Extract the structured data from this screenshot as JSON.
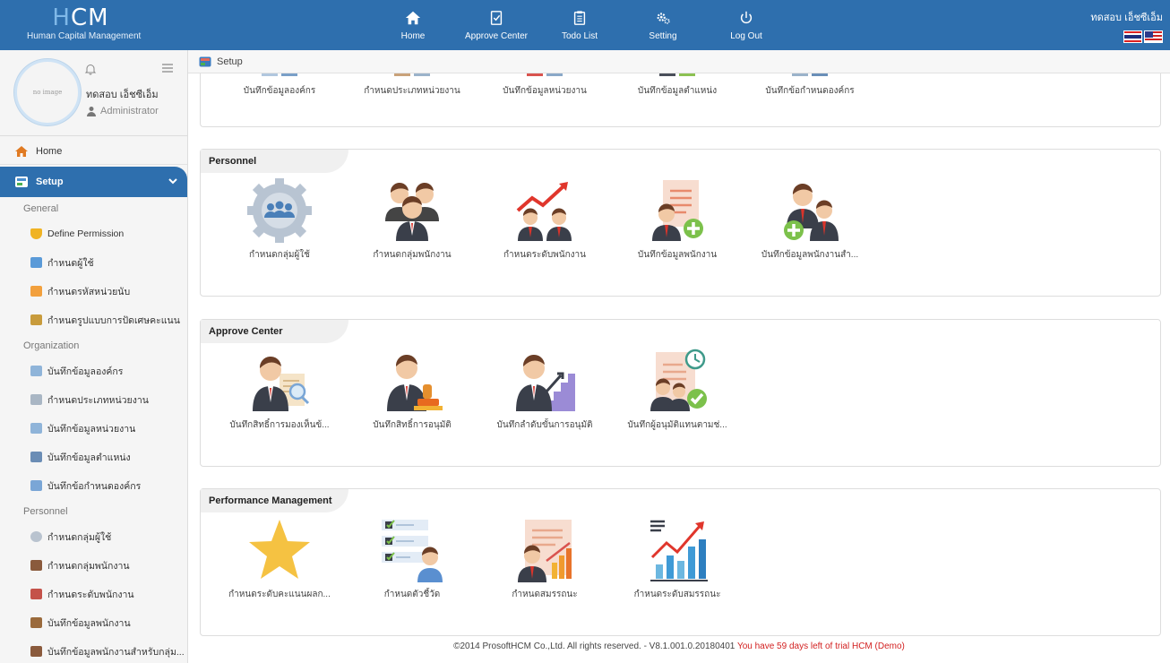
{
  "header": {
    "brand_logo": "HCM",
    "brand_subtitle": "Human Capital Management",
    "nav": [
      {
        "label": "Home",
        "icon": "home-icon"
      },
      {
        "label": "Approve Center",
        "icon": "approve-icon"
      },
      {
        "label": "Todo List",
        "icon": "clipboard-icon"
      },
      {
        "label": "Setting",
        "icon": "gears-icon"
      },
      {
        "label": "Log Out",
        "icon": "power-icon"
      }
    ],
    "user_name": "ทดสอบ เอ็ชซีเอ็ม"
  },
  "sidebar": {
    "avatar_text": "no image",
    "user_name": "ทดสอบ เอ็ชซีเอ็ม",
    "user_role": "Administrator",
    "home_label": "Home",
    "setup_label": "Setup",
    "groups": [
      {
        "title": "General",
        "items": [
          "Define Permission",
          "กำหนดผู้ใช้",
          "กำหนดรหัสหน่วยนับ",
          "กำหนดรูปแบบการปัดเศษคะแนน"
        ]
      },
      {
        "title": "Organization",
        "items": [
          "บันทึกข้อมูลองค์กร",
          "กำหนดประเภทหน่วยงาน",
          "บันทึกข้อมูลหน่วยงาน",
          "บันทึกข้อมูลตำแหน่ง",
          "บันทึกข้อกำหนดองค์กร"
        ]
      },
      {
        "title": "Personnel",
        "items": [
          "กำหนดกลุ่มผู้ใช้",
          "กำหนดกลุ่มพนักงาน",
          "กำหนดระดับพนักงาน",
          "บันทึกข้อมูลพนักงาน",
          "บันทึกข้อมูลพนักงานสำหรับกลุ่ม..."
        ]
      }
    ]
  },
  "breadcrumb": "Setup",
  "sections": {
    "organization_partial": {
      "items": [
        "บันทึกข้อมูลองค์กร",
        "กำหนดประเภทหน่วยงาน",
        "บันทึกข้อมูลหน่วยงาน",
        "บันทึกข้อมูลตำแหน่ง",
        "บันทึกข้อกำหนดองค์กร"
      ]
    },
    "personnel": {
      "title": "Personnel",
      "items": [
        "กำหนดกลุ่มผู้ใช้",
        "กำหนดกลุ่มพนักงาน",
        "กำหนดระดับพนักงาน",
        "บันทึกข้อมูลพนักงาน",
        "บันทึกข้อมูลพนักงานสำ..."
      ]
    },
    "approve_center": {
      "title": "Approve Center",
      "items": [
        "บันทึกสิทธิ์การมองเห็นข้...",
        "บันทึกสิทธิ์การอนุมัติ",
        "บันทึกลำดับขั้นการอนุมัติ",
        "บันทึกผู้อนุมัติแทนตามช่..."
      ]
    },
    "performance": {
      "title": "Performance Management",
      "items": [
        "กำหนดระดับคะแนนผลก...",
        "กำหนดตัวชี้วัด",
        "กำหนดสมรรถนะ",
        "กำหนดระดับสมรรถนะ"
      ]
    }
  },
  "footer": {
    "copyright": "©2014 ProsoftHCM Co.,Ltd. All rights reserved. - V8.1.001.0.20180401",
    "trial": "You have 59 days left of trial HCM (Demo)"
  },
  "colors": {
    "primary": "#2e6fae",
    "trial_text": "#d21f1f"
  }
}
